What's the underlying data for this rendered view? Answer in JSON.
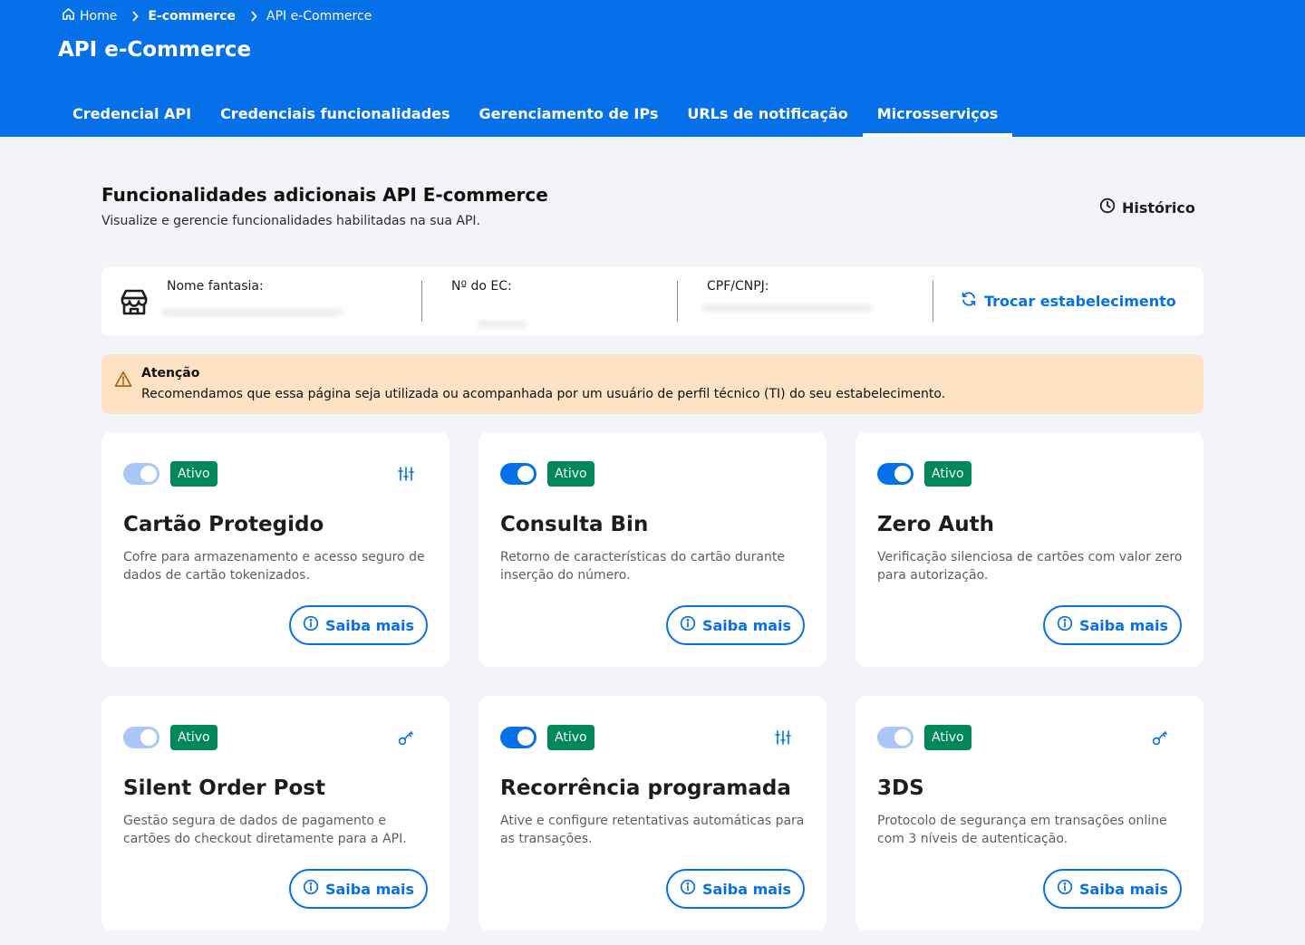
{
  "breadcrumb": [
    {
      "label": "Home",
      "icon": "home-icon"
    },
    {
      "label": "E-commerce"
    },
    {
      "label": "API e-Commerce"
    }
  ],
  "header": {
    "title": "API e-Commerce"
  },
  "tabs": [
    {
      "label": "Credencial API"
    },
    {
      "label": "Credenciais funcionalidades"
    },
    {
      "label": "Gerenciamento de IPs"
    },
    {
      "label": "URLs de notificação"
    },
    {
      "label": "Microsserviços",
      "active": true
    }
  ],
  "section": {
    "title": "Funcionalidades adicionais API E-commerce",
    "subtitle": "Visualize e gerencie funcionalidades habilitadas na sua API.",
    "history_label": "Histórico"
  },
  "establishment": {
    "name_label": "Nome fantasia:",
    "ec_label": "Nº do EC:",
    "doc_label": "CPF/CNPJ:",
    "swap_label": "Trocar estabelecimento"
  },
  "alert": {
    "title": "Atenção",
    "text": "Recomendamos que essa página seja utilizada ou acompanhada por um usuário de perfil técnico (TI) do seu estabelecimento."
  },
  "colors": {
    "brand": "#0570e8",
    "status_active": "#00875a",
    "alert_bg": "#fde3c4"
  },
  "cards": [
    {
      "title": "Cartão Protegido",
      "desc": "Cofre para armazenamento e acesso seguro de dados de cartão tokenizados.",
      "status": "Ativo",
      "toggle": "on-disabled",
      "action_icon": "sliders-icon",
      "button": "Saiba mais"
    },
    {
      "title": "Consulta Bin",
      "desc": "Retorno de características do cartão durante inserção do número.",
      "status": "Ativo",
      "toggle": "on",
      "action_icon": "",
      "button": "Saiba mais"
    },
    {
      "title": "Zero Auth",
      "desc": "Verificação silenciosa de cartões com valor zero para autorização.",
      "status": "Ativo",
      "toggle": "on",
      "action_icon": "",
      "button": "Saiba mais"
    },
    {
      "title": "Silent Order Post",
      "desc": "Gestão segura de dados de pagamento e cartões do checkout diretamente para a API.",
      "status": "Ativo",
      "toggle": "on-disabled",
      "action_icon": "key-icon",
      "button": "Saiba mais"
    },
    {
      "title": "Recorrência programada",
      "desc": "Ative e configure retentativas automáticas para as transações.",
      "status": "Ativo",
      "toggle": "on",
      "action_icon": "sliders-icon",
      "button": "Saiba mais"
    },
    {
      "title": "3DS",
      "desc": "Protocolo de segurança em transações online com 3 níveis de autenticação.",
      "status": "Ativo",
      "toggle": "on-disabled",
      "action_icon": "key-icon",
      "button": "Saiba mais"
    }
  ]
}
